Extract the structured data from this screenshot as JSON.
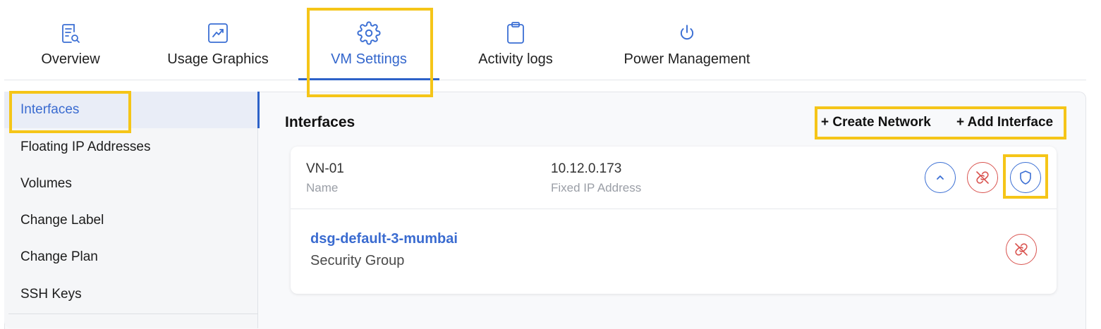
{
  "tabs": [
    {
      "label": "Overview",
      "icon": "overview-report-icon"
    },
    {
      "label": "Usage Graphics",
      "icon": "chart-trend-icon"
    },
    {
      "label": "VM Settings",
      "icon": "gear-icon",
      "active": true
    },
    {
      "label": "Activity logs",
      "icon": "clipboard-icon"
    },
    {
      "label": "Power Management",
      "icon": "power-icon"
    }
  ],
  "sidebar": {
    "items": [
      {
        "label": "Interfaces",
        "active": true
      },
      {
        "label": "Floating IP Addresses"
      },
      {
        "label": "Volumes"
      },
      {
        "label": "Change Label"
      },
      {
        "label": "Change Plan"
      },
      {
        "label": "SSH Keys"
      }
    ]
  },
  "main": {
    "title": "Interfaces",
    "actions": {
      "create_network": "+ Create Network",
      "add_interface": "+ Add Interface"
    },
    "interface": {
      "name_value": "VN-01",
      "name_label": "Name",
      "ip_value": "10.12.0.173",
      "ip_label": "Fixed IP Address",
      "security_group": {
        "name": "dsg-default-3-mumbai",
        "label": "Security Group"
      }
    }
  },
  "colors": {
    "accent": "#3366cc",
    "highlight": "#f5c518",
    "danger": "#d9534f"
  }
}
